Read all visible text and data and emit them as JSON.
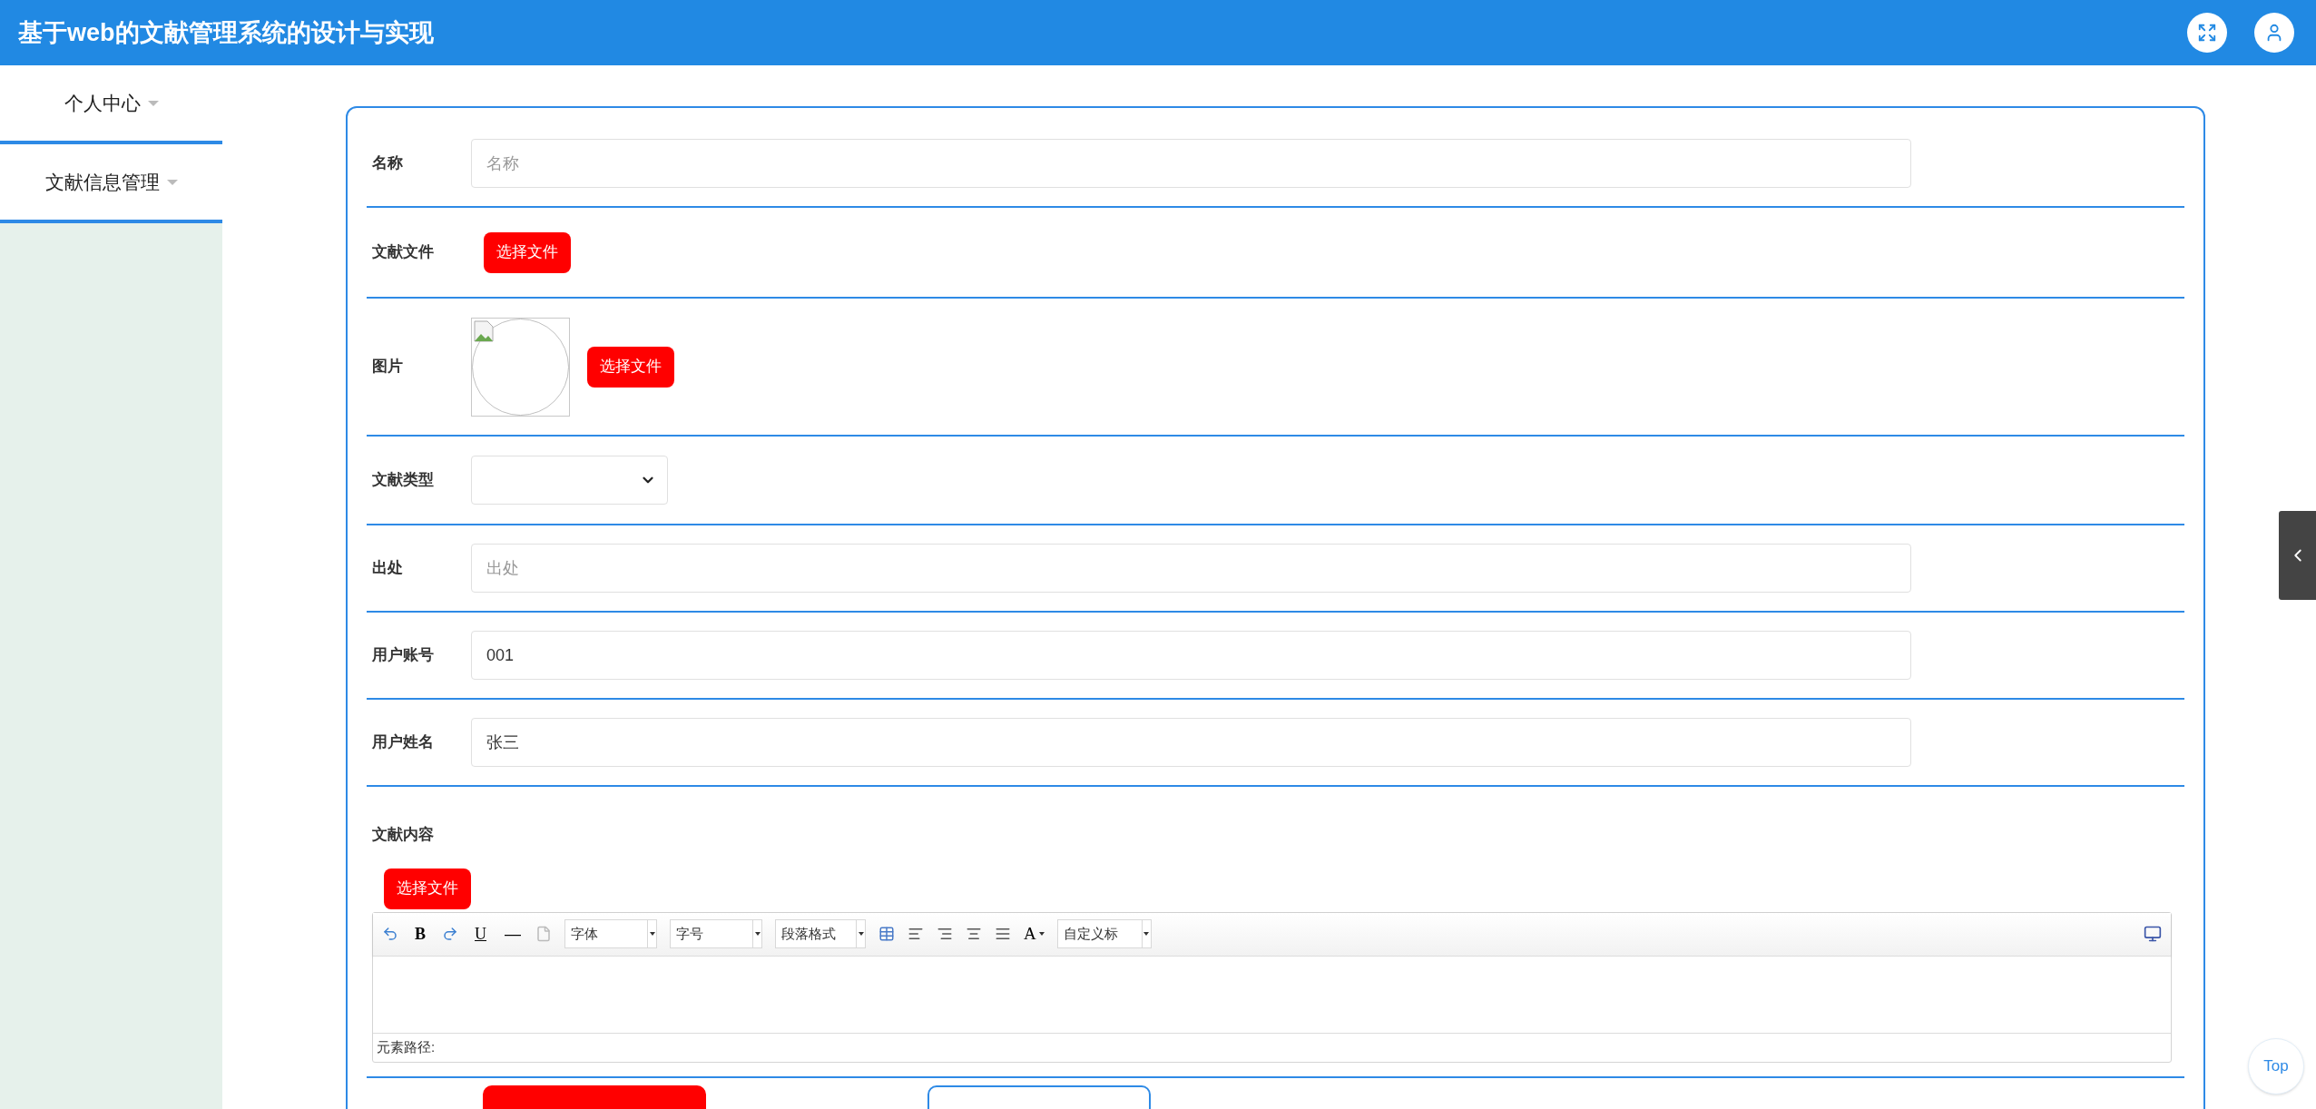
{
  "header": {
    "title": "基于web的文献管理系统的设计与实现"
  },
  "sidebar": {
    "items": [
      {
        "label": "个人中心"
      },
      {
        "label": "文献信息管理"
      }
    ]
  },
  "form": {
    "rows": [
      {
        "kind": "input",
        "label": "名称",
        "placeholder": "名称"
      },
      {
        "kind": "file",
        "label": "文献文件",
        "button": "选择文件"
      },
      {
        "kind": "image",
        "label": "图片",
        "button": "选择文件"
      },
      {
        "kind": "select",
        "label": "文献类型"
      },
      {
        "kind": "input",
        "label": "出处",
        "placeholder": "出处"
      },
      {
        "kind": "input",
        "label": "用户账号",
        "value": "001"
      },
      {
        "kind": "input",
        "label": "用户姓名",
        "value": "张三"
      },
      {
        "kind": "editor",
        "label": "文献内容",
        "button": "选择文件",
        "editor": {
          "bold": "B",
          "underline": "U",
          "rule": "—",
          "font_color": "A",
          "dropdowns": [
            "字体",
            "字号",
            "段落格式"
          ],
          "heading_dropdown": "自定义标",
          "path_label": "元素路径:"
        }
      }
    ],
    "actions": [
      {
        "kind": "primary"
      },
      {
        "kind": "outline"
      }
    ]
  },
  "back_to_top": "Top"
}
